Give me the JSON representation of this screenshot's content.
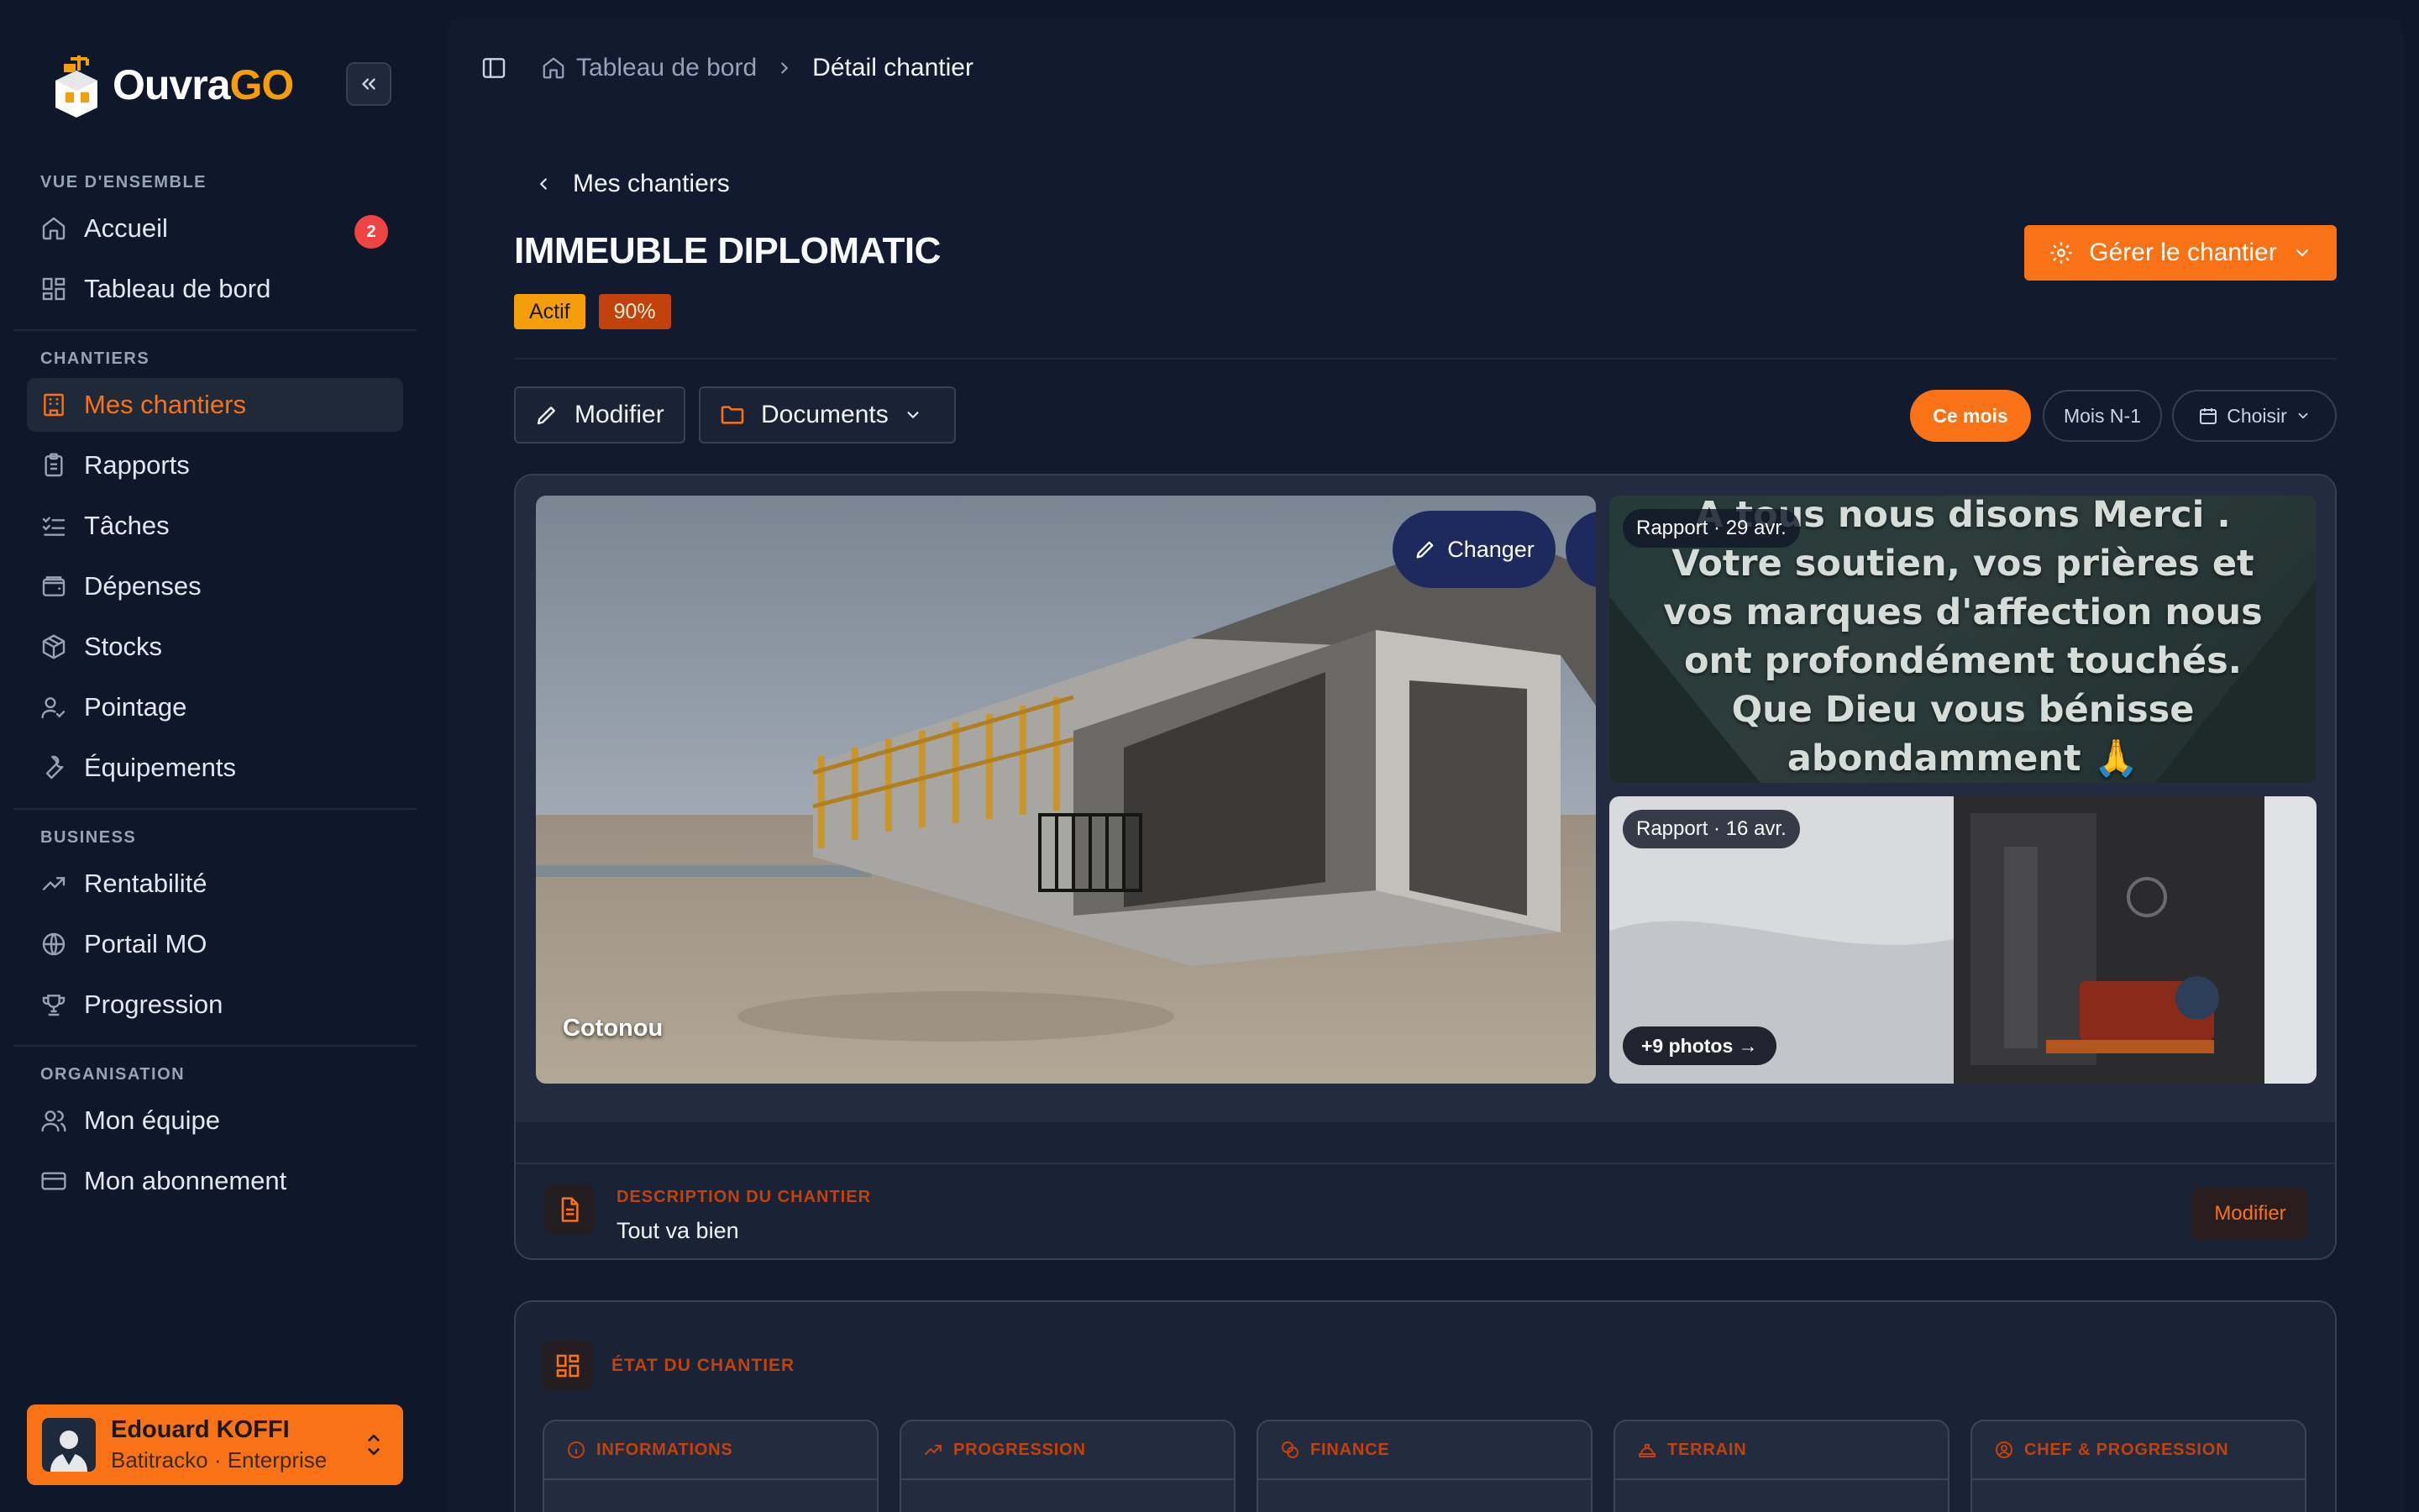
{
  "brand": {
    "name_main": "Ouvra",
    "name_accent": "GO"
  },
  "sidebar": {
    "sections": [
      {
        "title": "VUE D'ENSEMBLE"
      },
      {
        "title": "CHANTIERS"
      },
      {
        "title": "BUSINESS"
      },
      {
        "title": "ORGANISATION"
      }
    ],
    "items": [
      {
        "label": "Accueil",
        "icon": "home-icon",
        "badge": "2"
      },
      {
        "label": "Tableau de bord",
        "icon": "dashboard-icon"
      },
      {
        "label": "Mes chantiers",
        "icon": "building-icon",
        "active": true
      },
      {
        "label": "Rapports",
        "icon": "clipboard-icon"
      },
      {
        "label": "Tâches",
        "icon": "checklist-icon"
      },
      {
        "label": "Dépenses",
        "icon": "wallet-icon"
      },
      {
        "label": "Stocks",
        "icon": "package-icon"
      },
      {
        "label": "Pointage",
        "icon": "user-check-icon"
      },
      {
        "label": "Équipements",
        "icon": "wrench-icon"
      },
      {
        "label": "Rentabilité",
        "icon": "trending-up-icon"
      },
      {
        "label": "Portail MO",
        "icon": "globe-icon"
      },
      {
        "label": "Progression",
        "icon": "trophy-icon"
      },
      {
        "label": "Mon équipe",
        "icon": "users-icon"
      },
      {
        "label": "Mon abonnement",
        "icon": "credit-card-icon"
      }
    ],
    "user": {
      "name": "Edouard KOFFI",
      "org": "Batitracko · Enterprise"
    }
  },
  "breadcrumb": {
    "home": "Tableau de bord",
    "current": "Détail chantier"
  },
  "page": {
    "back_label": "Mes chantiers",
    "title": "IMMEUBLE DIPLOMATIC",
    "status_tag": "Actif",
    "progress_tag": "90%",
    "manage_button": "Gérer le chantier"
  },
  "toolbar": {
    "edit_label": "Modifier",
    "documents_label": "Documents",
    "period_current": "Ce mois",
    "period_previous": "Mois N-1",
    "period_choose": "Choisir"
  },
  "gallery": {
    "change_label": "Changer",
    "city": "Cotonou",
    "report1_chip": "Rapport · 29 avr.",
    "report1_text_lines": [
      "A tous nous disons Merci .",
      "Votre soutien, vos prières et",
      "vos marques d'affection nous",
      "ont profondément touchés.",
      "Que Dieu vous bénisse",
      "abondamment 🙏"
    ],
    "report2_chip": "Rapport · 16 avr.",
    "more_photos": "+9 photos →"
  },
  "description": {
    "title": "DESCRIPTION DU CHANTIER",
    "text": "Tout va bien",
    "edit_label": "Modifier"
  },
  "state": {
    "title": "ÉTAT DU CHANTIER",
    "tiles": [
      {
        "label": "INFORMATIONS",
        "icon": "info-icon"
      },
      {
        "label": "PROGRESSION",
        "icon": "trending-up-icon"
      },
      {
        "label": "FINANCE",
        "icon": "coins-icon"
      },
      {
        "label": "TERRAIN",
        "icon": "hard-hat-icon"
      },
      {
        "label": "CHEF & PROGRESSION",
        "icon": "user-circle-icon"
      }
    ]
  },
  "colors": {
    "accent": "#f97316",
    "warning": "#f59e0b",
    "danger": "#ef4444",
    "background": "#0f172a"
  }
}
